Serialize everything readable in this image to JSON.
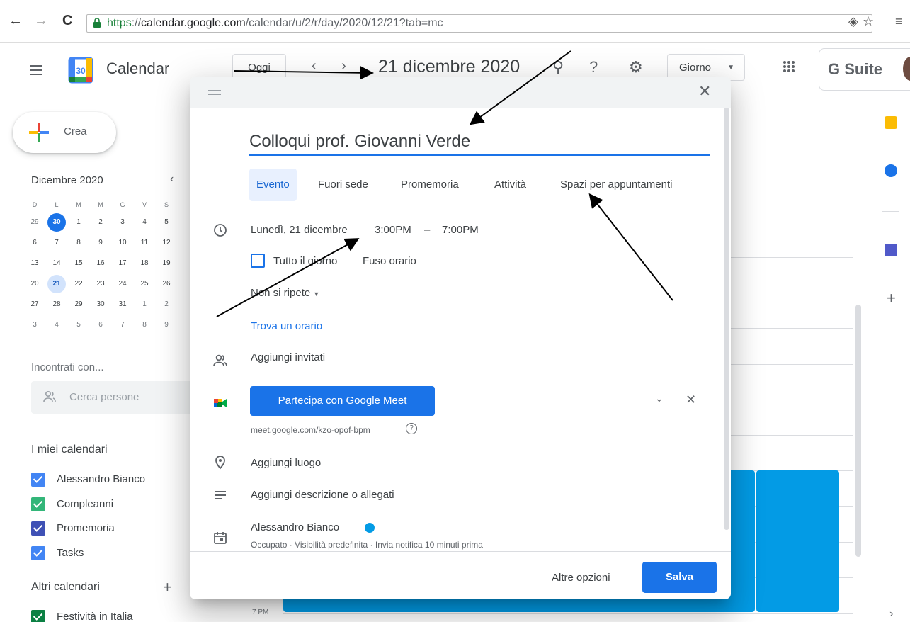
{
  "browser": {
    "url_secure": "https",
    "url_sep": "://",
    "url_host": "calendar.google.com",
    "url_path": "/calendar/u/2/r/day/2020/12/21?tab=mc"
  },
  "header": {
    "app_title": "Calendar",
    "logo_day": "30",
    "today_label": "Oggi",
    "date_title": "21 dicembre 2020",
    "view_label": "Giorno",
    "gsuite_label": "G Suite"
  },
  "sidebar": {
    "create_label": "Crea",
    "mini_month": "Dicembre 2020",
    "weekdays": [
      "D",
      "L",
      "M",
      "M",
      "G",
      "V",
      "S"
    ],
    "weeks": [
      [
        "29",
        "30",
        "1",
        "2",
        "3",
        "4",
        "5"
      ],
      [
        "6",
        "7",
        "8",
        "9",
        "10",
        "11",
        "12"
      ],
      [
        "13",
        "14",
        "15",
        "16",
        "17",
        "18",
        "19"
      ],
      [
        "20",
        "21",
        "22",
        "23",
        "24",
        "25",
        "26"
      ],
      [
        "27",
        "28",
        "29",
        "30",
        "31",
        "1",
        "2"
      ],
      [
        "3",
        "4",
        "5",
        "6",
        "7",
        "8",
        "9"
      ]
    ],
    "meet_with_title": "Incontrati con...",
    "search_people_placeholder": "Cerca persone",
    "my_calendars_title": "I miei calendari",
    "my_calendars": [
      {
        "label": "Alessandro Bianco",
        "color": "#4285f4"
      },
      {
        "label": "Compleanni",
        "color": "#33b679"
      },
      {
        "label": "Promemoria",
        "color": "#3f51b5"
      },
      {
        "label": "Tasks",
        "color": "#4285f4"
      }
    ],
    "other_calendars_title": "Altri calendari",
    "other_calendars": [
      {
        "label": "Festività in Italia",
        "color": "#0b8043"
      }
    ]
  },
  "grid": {
    "hour_label": "7 PM"
  },
  "dialog": {
    "title_value": "Colloqui prof. Giovanni Verde",
    "tabs": [
      "Evento",
      "Fuori sede",
      "Promemoria",
      "Attività",
      "Spazi per appuntamenti"
    ],
    "date_text": "Lunedì, 21 dicembre",
    "start_time": "3:00PM",
    "dash": "–",
    "end_time": "7:00PM",
    "all_day_label": "Tutto il giorno",
    "timezone_label": "Fuso orario",
    "repeat_label": "Non si ripete",
    "find_time_label": "Trova un orario",
    "add_guests_label": "Aggiungi invitati",
    "meet_button_label": "Partecipa con Google Meet",
    "meet_link": "meet.google.com/kzo-opof-bpm",
    "add_location_label": "Aggiungi luogo",
    "add_description_label": "Aggiungi descrizione o allegati",
    "calendar_owner": "Alessandro Bianco",
    "calendar_details": "Occupato · Visibilità predefinita · Invia notifica 10 minuti prima",
    "more_options_label": "Altre opzioni",
    "save_label": "Salva"
  }
}
